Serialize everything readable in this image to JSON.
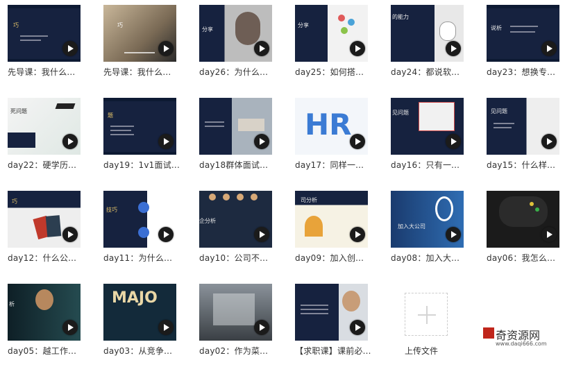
{
  "tiles": [
    {
      "caption": "先导课：我什么..."
    },
    {
      "caption": "先导课：我什么..."
    },
    {
      "caption": "day26：为什么..."
    },
    {
      "caption": "day25：如何搭..."
    },
    {
      "caption": "day24：都说软..."
    },
    {
      "caption": "day23：想换专..."
    },
    {
      "caption": "day22：硬学历..."
    },
    {
      "caption": "day19：1v1面试..."
    },
    {
      "caption": "day18群体面试..."
    },
    {
      "caption": "day17：同样一..."
    },
    {
      "caption": "day16：只有一..."
    },
    {
      "caption": "day15：什么样..."
    },
    {
      "caption": "day12：什么公..."
    },
    {
      "caption": "day11：为什么..."
    },
    {
      "caption": "day10：公司不..."
    },
    {
      "caption": "day09：加入创..."
    },
    {
      "caption": "day08：加入大..."
    },
    {
      "caption": "day06：我怎么..."
    },
    {
      "caption": "day05：越工作..."
    },
    {
      "caption": "day03：从竞争..."
    },
    {
      "caption": "day02：作为菜..."
    },
    {
      "caption": "【求职课】课前必..."
    }
  ],
  "thumb_text": {
    "t0_title": "巧",
    "t1_title": "巧",
    "t2_title": "分享",
    "t3_title": "分享",
    "t4_title": "的能力",
    "t5_title": "说析",
    "t6_title": "死问题",
    "t7_title": "题",
    "t10_title": "见问题",
    "t11_title": "见问题",
    "t12_title": "巧",
    "t13_title": "技巧",
    "t14_title": "企分析",
    "t15_title": "司分析",
    "t16_title": "加入大公司",
    "t18_title": "析",
    "t19_title": "MAJO",
    "t9_title": "HR"
  },
  "upload": {
    "label": "上传文件"
  },
  "watermark": {
    "name": "奇资源网",
    "url": "www.daqi666.com"
  }
}
